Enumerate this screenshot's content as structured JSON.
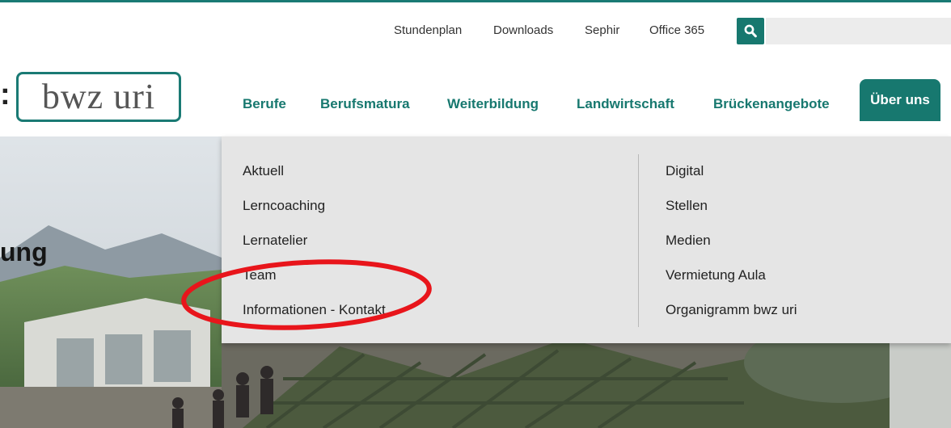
{
  "colors": {
    "brand": "#17786f",
    "dropdown_bg": "#e5e5e5",
    "annotation": "#e8151b"
  },
  "utility": {
    "links": [
      {
        "label": "Stundenplan"
      },
      {
        "label": "Downloads"
      },
      {
        "label": "Sephir"
      },
      {
        "label": "Office 365"
      }
    ],
    "search_icon": "search-icon",
    "search_value": ""
  },
  "logo": {
    "prefix": ":",
    "text": "bwz uri"
  },
  "nav": {
    "items": [
      {
        "label": "Berufe"
      },
      {
        "label": "Berufsmatura"
      },
      {
        "label": "Weiterbildung"
      },
      {
        "label": "Landwirtschaft"
      },
      {
        "label": "Brückenangebote"
      }
    ],
    "active": {
      "label": "Über uns"
    }
  },
  "hero": {
    "headline": "ung"
  },
  "dropdown": {
    "left": [
      "Aktuell",
      "Lerncoaching",
      "Lernatelier",
      "Team",
      "Informationen - Kontakt"
    ],
    "right": [
      "Digital",
      "Stellen",
      "Medien",
      "Vermietung Aula",
      "Organigramm bwz uri"
    ]
  }
}
